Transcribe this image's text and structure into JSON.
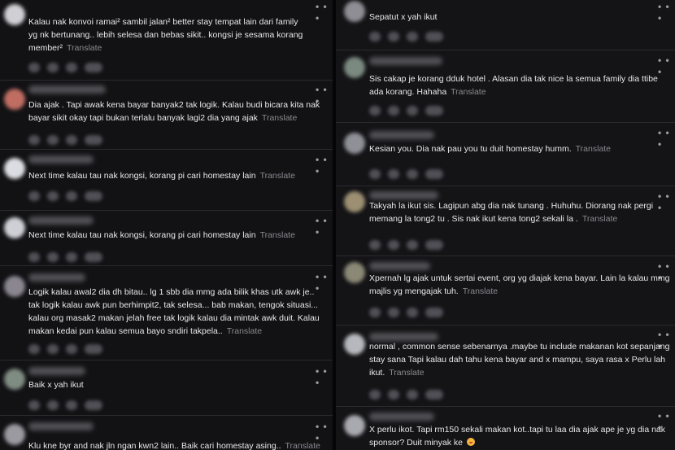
{
  "ui": {
    "more_glyph": "• • •",
    "translate_label": "Translate"
  },
  "left_comments": [
    {
      "text": "Kalau nak konvoi ramai² sambil jalan² better stay tempat lain dari family yg nk bertunang.. lebih selesa dan bebas sikit.. kongsi je sesama korang member²",
      "avatar_color": "#cfcfd4"
    },
    {
      "text": "Dia ajak . Tapi awak kena bayar banyak2 tak logik. Kalau budi bicara kita nak bayar sikit okay tapi bukan terlalu banyak lagi2 dia yang ajak",
      "avatar_color": "#c06d62"
    },
    {
      "text": "Next time kalau tau nak kongsi, korang pi cari homestay lain",
      "avatar_color": "#dcdde2"
    },
    {
      "text": "Next time kalau tau nak kongsi, korang pi cari homestay lain",
      "avatar_color": "#cfd0d6"
    },
    {
      "text": "Logik kalau awal2 dia dh bitau.. lg 1 sbb dia mmg ada bilik khas utk awk je.. tak logik kalau awk pun berhimpit2, tak selesa... bab makan, tengok situasi... kalau org masak2 makan jelah free tak logik kalau dia mintak awk duit. Kalau makan kedai pun kalau semua bayo sndiri takpela..",
      "avatar_color": "#8a8790"
    },
    {
      "text": "Baik x yah ikut",
      "avatar_color": "#7f8c82"
    },
    {
      "text": "Klu kne byr and nak jln ngan kwn2 lain.. Baik cari homestay asing..",
      "avatar_color": "#9a9aa0"
    }
  ],
  "right_comments": [
    {
      "text": "Sepatut x yah ikut",
      "avatar_color": "#8e8e94"
    },
    {
      "text": "Sis cakap je korang dduk hotel . Alasan dia tak nice la semua family dia ttibe ada korang. Hahaha",
      "avatar_color": "#7b8a80"
    },
    {
      "text": "Kesian you. Dia nak pau you tu duit homestay humm.",
      "avatar_color": "#909098"
    },
    {
      "text": "Takyah la ikut sis. Lagipun abg dia nak tunang . Huhuhu. Diorang nak pergi memang la tong2 tu . Sis nak ikut kena tong2 sekali la .",
      "avatar_color": "#9c8f72"
    },
    {
      "text": "Xpernah lg ajak untuk sertai event, org yg diajak kena bayar. Lain la kalau mmg majlis yg mengajak tuh.",
      "avatar_color": "#8b8876"
    },
    {
      "text": "normal , common sense sebenarnya .maybe tu include makanan kot sepanjang stay sana Tapi kalau dah tahu kena bayar and x mampu, saya rasa x Perlu lah ikut.",
      "avatar_color": "#b7b8be"
    },
    {
      "text": "X perlu ikot. Tapi rm150 sekali makan kot..tapi tu laa dia ajak ape je yg dia nak sponsor? Duit minyak ke",
      "avatar_color": "#a9a9b0",
      "emoji": "grinning-face-emoji"
    }
  ]
}
